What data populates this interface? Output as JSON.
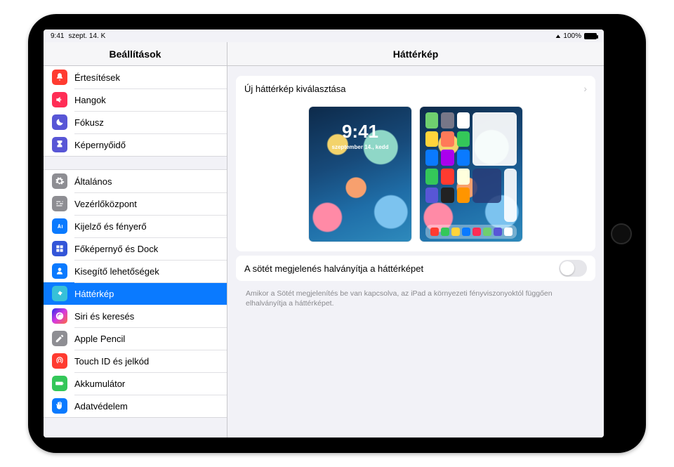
{
  "statusbar": {
    "time": "9:41",
    "date": "szept. 14. K",
    "battery_pct": "100%"
  },
  "titles": {
    "sidebar": "Beállítások",
    "detail": "Háttérkép"
  },
  "sidebar_groups": [
    {
      "items": [
        {
          "key": "notifications",
          "label": "Értesítések",
          "icon": "bell",
          "bg": "#ff3b30"
        },
        {
          "key": "sounds",
          "label": "Hangok",
          "icon": "speaker",
          "bg": "#ff2d55"
        },
        {
          "key": "focus",
          "label": "Fókusz",
          "icon": "moon",
          "bg": "#5856d6"
        },
        {
          "key": "screentime",
          "label": "Képernyőidő",
          "icon": "hourglass",
          "bg": "#5856d6"
        }
      ]
    },
    {
      "items": [
        {
          "key": "general",
          "label": "Általános",
          "icon": "gear",
          "bg": "#8e8e93"
        },
        {
          "key": "controlcenter",
          "label": "Vezérlőközpont",
          "icon": "sliders",
          "bg": "#8e8e93"
        },
        {
          "key": "display",
          "label": "Kijelző és fényerő",
          "icon": "aa",
          "bg": "#0a7aff"
        },
        {
          "key": "homescreen",
          "label": "Főképernyő és Dock",
          "icon": "grid",
          "bg": "#3355d8"
        },
        {
          "key": "accessibility",
          "label": "Kisegítő lehetőségek",
          "icon": "person",
          "bg": "#0a7aff"
        },
        {
          "key": "wallpaper",
          "label": "Háttérkép",
          "icon": "flower",
          "bg": "#37c1d8",
          "selected": true
        },
        {
          "key": "siri",
          "label": "Siri és keresés",
          "icon": "siri",
          "bg": "linear-gradient(135deg,#2a2aee,#d63adf,#ff6a3d)"
        },
        {
          "key": "pencil",
          "label": "Apple Pencil",
          "icon": "pencil",
          "bg": "#8e8e93"
        },
        {
          "key": "touchid",
          "label": "Touch ID és jelkód",
          "icon": "fingerprint",
          "bg": "#ff3b30"
        },
        {
          "key": "battery",
          "label": "Akkumulátor",
          "icon": "battery",
          "bg": "#34c759"
        },
        {
          "key": "privacy",
          "label": "Adatvédelem",
          "icon": "hand",
          "bg": "#0a7aff"
        }
      ]
    }
  ],
  "detail": {
    "choose_new": "Új háttérkép kiválasztása",
    "lock_preview": {
      "time": "9:41",
      "date": "szeptember 14., kedd"
    },
    "dim_label": "A sötét megjelenés halványítja a háttérképet",
    "dim_on": false,
    "footer": "Amikor a Sötét megjelenítés be van kapcsolva, az iPad a környezeti fényviszonyoktól függően elhalványítja a háttérképet."
  }
}
